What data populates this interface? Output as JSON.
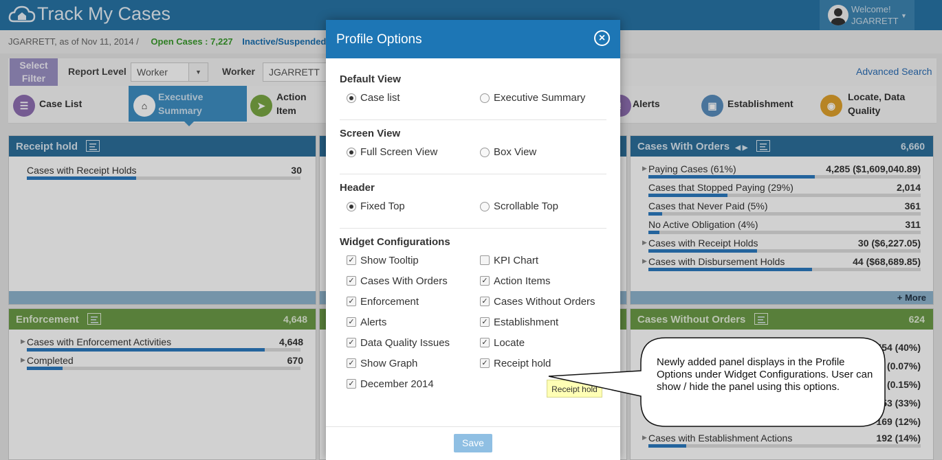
{
  "app": {
    "title": "Track My Cases"
  },
  "welcome": {
    "greeting": "Welcome!",
    "user": "JGARRETT"
  },
  "info": {
    "user_date": "JGARRETT, as of Nov 11, 2014  /",
    "open_cases": "Open Cases : 7,227",
    "inactive": "Inactive/Suspended"
  },
  "filter": {
    "select_label": "Select Filter",
    "report_level_label": "Report Level",
    "report_level_value": "Worker",
    "worker_label": "Worker",
    "worker_value": "JGARRETT",
    "advanced": "Advanced Search"
  },
  "tabs": [
    {
      "label": "Case List",
      "color": "#8f6fb3"
    },
    {
      "label": "Executive Summary",
      "color": "#3f8fc4"
    },
    {
      "label": "Action Item",
      "color": "#7aa844"
    },
    {
      "label": "Alerts",
      "color": "#8f6fb3"
    },
    {
      "label": "Establishment",
      "color": "#5a8ebd"
    },
    {
      "label": "Locate, Data Quality",
      "color": "#e0a22c"
    }
  ],
  "panels": {
    "receipt_hold": {
      "title": "Receipt hold",
      "rows": [
        {
          "label": "Cases with Receipt Holds",
          "value": "30",
          "fill": 0.4
        }
      ]
    },
    "cases_with_orders": {
      "title": "Cases With Orders",
      "count": "6,660",
      "more": "+ More",
      "rows": [
        {
          "label": "Paying Cases (61%)",
          "value": "4,285 ($1,609,040.89)",
          "fill": 0.61,
          "expand": true
        },
        {
          "label": "Cases that Stopped Paying (29%)",
          "value": "2,014",
          "fill": 0.29,
          "expand": false
        },
        {
          "label": "Cases that Never Paid (5%)",
          "value": "361",
          "fill": 0.05,
          "expand": false
        },
        {
          "label": "No Active Obligation (4%)",
          "value": "311",
          "fill": 0.04,
          "expand": false
        },
        {
          "label": "Cases with Receipt Holds",
          "value": "30 ($6,227.05)",
          "fill": 0.4,
          "expand": true
        },
        {
          "label": "Cases with Disbursement Holds",
          "value": "44 ($68,689.85)",
          "fill": 0.6,
          "expand": true
        }
      ]
    },
    "enforcement": {
      "title": "Enforcement",
      "count": "4,648",
      "rows": [
        {
          "label": "Cases with Enforcement Activities",
          "value": "4,648",
          "fill": 0.87,
          "expand": true
        },
        {
          "label": "Completed",
          "value": "670",
          "fill": 0.13,
          "expand": true
        }
      ]
    },
    "cases_without_orders": {
      "title": "Cases Without Orders",
      "count": "624",
      "partial_values": [
        "554 (40%)",
        "(0.07%)",
        "(0.15%)",
        "53 (33%)",
        "169 (12%)"
      ],
      "last_row": {
        "label": "Cases with Establishment Actions",
        "value": "192 (14%)",
        "fill": 0.14
      }
    }
  },
  "modal": {
    "title": "Profile Options",
    "default_view": {
      "heading": "Default View",
      "options": [
        "Case list",
        "Executive Summary"
      ],
      "selected": 0
    },
    "screen_view": {
      "heading": "Screen View",
      "options": [
        "Full Screen View",
        "Box View"
      ],
      "selected": 0
    },
    "header": {
      "heading": "Header",
      "options": [
        "Fixed Top",
        "Scrollable Top"
      ],
      "selected": 0
    },
    "widgets": {
      "heading": "Widget Configurations",
      "left": [
        {
          "label": "Show Tooltip",
          "checked": true
        },
        {
          "label": "Cases With Orders",
          "checked": true
        },
        {
          "label": "Enforcement",
          "checked": true
        },
        {
          "label": "Alerts",
          "checked": true
        },
        {
          "label": "Data Quality Issues",
          "checked": true
        },
        {
          "label": "Show Graph",
          "checked": true
        },
        {
          "label": "December 2014",
          "checked": true
        }
      ],
      "right": [
        {
          "label": "KPI Chart",
          "checked": false
        },
        {
          "label": "Action Items",
          "checked": true
        },
        {
          "label": "Cases Without Orders",
          "checked": true
        },
        {
          "label": "Establishment",
          "checked": true
        },
        {
          "label": "Locate",
          "checked": true
        },
        {
          "label": "Receipt hold",
          "checked": true
        }
      ]
    },
    "save": "Save"
  },
  "tooltip": "Receipt hold",
  "callout": "Newly added panel displays in the Profile Options under Widget Configurations. User can show / hide the panel using this options."
}
